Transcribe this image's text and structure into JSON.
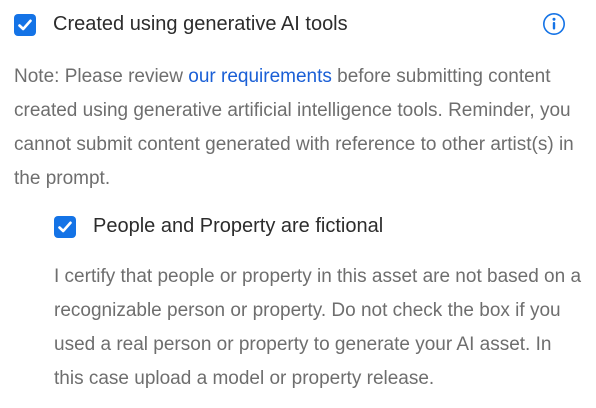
{
  "generative_ai": {
    "checked": true,
    "label": "Created using generative AI tools",
    "info_icon": "info-circle-icon",
    "note_prefix": "Note: Please review ",
    "note_link": "our requirements",
    "note_suffix": " before submitting content created using generative artificial intelligence tools. Reminder, you cannot submit content generated with reference to other artist(s) in the prompt."
  },
  "fictional": {
    "checked": true,
    "label": "People and Property are fictional",
    "description": "I certify that people or property in this asset are not based on a recognizable person or property. Do not check the box if you used a real person or property to generate your AI asset. In this case upload a model or property release."
  },
  "colors": {
    "checkbox_fill": "#1473e6",
    "link": "#1a5fd6",
    "info_icon": "#1473e6",
    "secondary_text": "#6e6e6e"
  }
}
